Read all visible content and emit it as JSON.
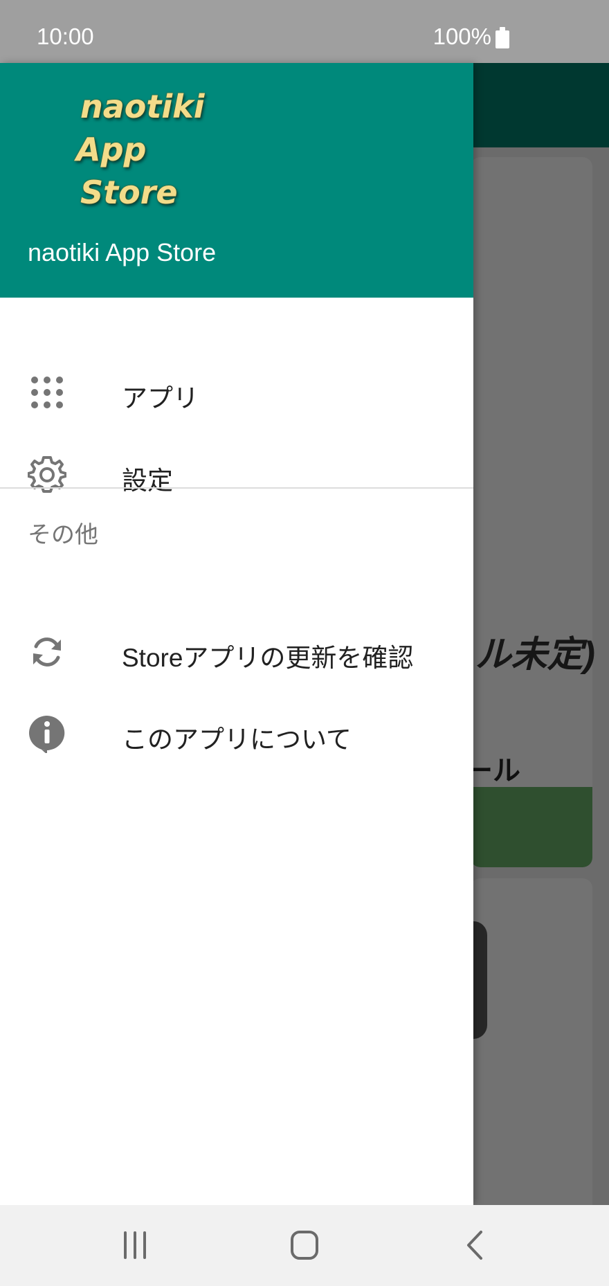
{
  "status_bar": {
    "time": "10:00",
    "battery": "100%"
  },
  "background": {
    "card_title_fragment": "ル未定)",
    "install_button_fragment": "ール"
  },
  "drawer": {
    "logo_lines": [
      "naotiki",
      "App",
      "Store"
    ],
    "header_title": "naotiki App Store",
    "items": [
      {
        "label": "アプリ",
        "icon": "apps-grid-icon"
      },
      {
        "label": "設定",
        "icon": "gear-icon"
      }
    ],
    "section_header": "その他",
    "other_items": [
      {
        "label": "Storeアプリの更新を確認",
        "icon": "refresh-icon"
      },
      {
        "label": "このアプリについて",
        "icon": "info-icon"
      }
    ]
  },
  "colors": {
    "header": "#00897b",
    "toolbar_dimmed": "#003830",
    "install_button_dimmed": "#2f4f2f"
  },
  "nav_bar": {
    "buttons": [
      "recent-apps-icon",
      "home-icon",
      "back-icon"
    ]
  }
}
